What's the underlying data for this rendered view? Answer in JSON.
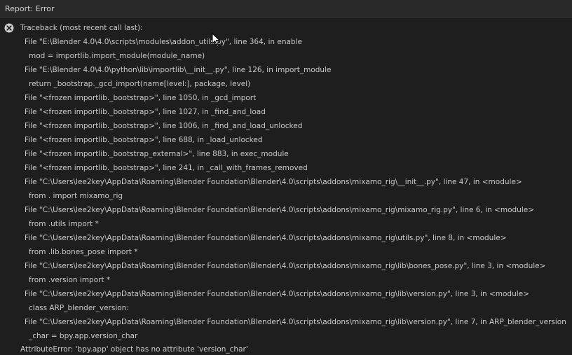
{
  "header": {
    "title": "Report: Error"
  },
  "report": {
    "icon": "error-circle-x-icon",
    "lines": [
      "Traceback (most recent call last):",
      "File \"E:\\Blender 4.0\\4.0\\scripts\\modules\\addon_utils.py\", line 364, in enable",
      "mod = importlib.import_module(module_name)",
      "File \"E:\\Blender 4.0\\4.0\\python\\lib\\importlib\\__init__.py\", line 126, in import_module",
      "return _bootstrap._gcd_import(name[level:], package, level)",
      "File \"<frozen importlib._bootstrap>\", line 1050, in _gcd_import",
      "File \"<frozen importlib._bootstrap>\", line 1027, in _find_and_load",
      "File \"<frozen importlib._bootstrap>\", line 1006, in _find_and_load_unlocked",
      "File \"<frozen importlib._bootstrap>\", line 688, in _load_unlocked",
      "File \"<frozen importlib._bootstrap_external>\", line 883, in exec_module",
      "File \"<frozen importlib._bootstrap>\", line 241, in _call_with_frames_removed",
      "File \"C:\\Users\\lee2key\\AppData\\Roaming\\Blender Foundation\\Blender\\4.0\\scripts\\addons\\mixamo_rig\\__init__.py\", line 47, in <module>",
      "from . import mixamo_rig",
      "File \"C:\\Users\\lee2key\\AppData\\Roaming\\Blender Foundation\\Blender\\4.0\\scripts\\addons\\mixamo_rig\\mixamo_rig.py\", line 6, in <module>",
      "from .utils import *",
      "File \"C:\\Users\\lee2key\\AppData\\Roaming\\Blender Foundation\\Blender\\4.0\\scripts\\addons\\mixamo_rig\\utils.py\", line 8, in <module>",
      "from .lib.bones_pose import *",
      "File \"C:\\Users\\lee2key\\AppData\\Roaming\\Blender Foundation\\Blender\\4.0\\scripts\\addons\\mixamo_rig\\lib\\bones_pose.py\", line 3, in <module>",
      "from .version import *",
      "File \"C:\\Users\\lee2key\\AppData\\Roaming\\Blender Foundation\\Blender\\4.0\\scripts\\addons\\mixamo_rig\\lib\\version.py\", line 3, in <module>",
      "class ARP_blender_version:",
      "File \"C:\\Users\\lee2key\\AppData\\Roaming\\Blender Foundation\\Blender\\4.0\\scripts\\addons\\mixamo_rig\\lib\\version.py\", line 7, in ARP_blender_version",
      "_char = bpy.app.version_char",
      "AttributeError: 'bpy.app' object has no attribute 'version_char'"
    ]
  },
  "colors": {
    "background": "#1e1e1e",
    "header_background": "#282828",
    "text": "#cccccc",
    "error_icon": "#cfcfcf"
  },
  "cursor_icon": "mouse-pointer-icon"
}
